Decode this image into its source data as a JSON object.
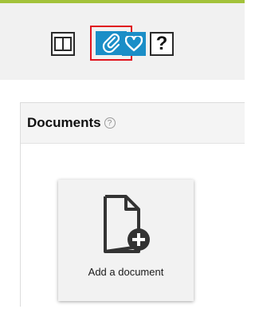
{
  "colors": {
    "top_bar": "#a3c23a",
    "accent_blue": "#1b8ec7",
    "selection_red": "#e0141e"
  },
  "toolbar": {
    "buttons": [
      {
        "icon": "split-view-icon"
      },
      {
        "icon": "paperclip-icon",
        "selected": true
      },
      {
        "icon": "heart-icon"
      },
      {
        "icon": "question-icon",
        "label": "?"
      }
    ]
  },
  "documents": {
    "title": "Documents",
    "help_glyph": "?",
    "add_button_label": "Add a document",
    "add_icon": "file-add-icon"
  }
}
